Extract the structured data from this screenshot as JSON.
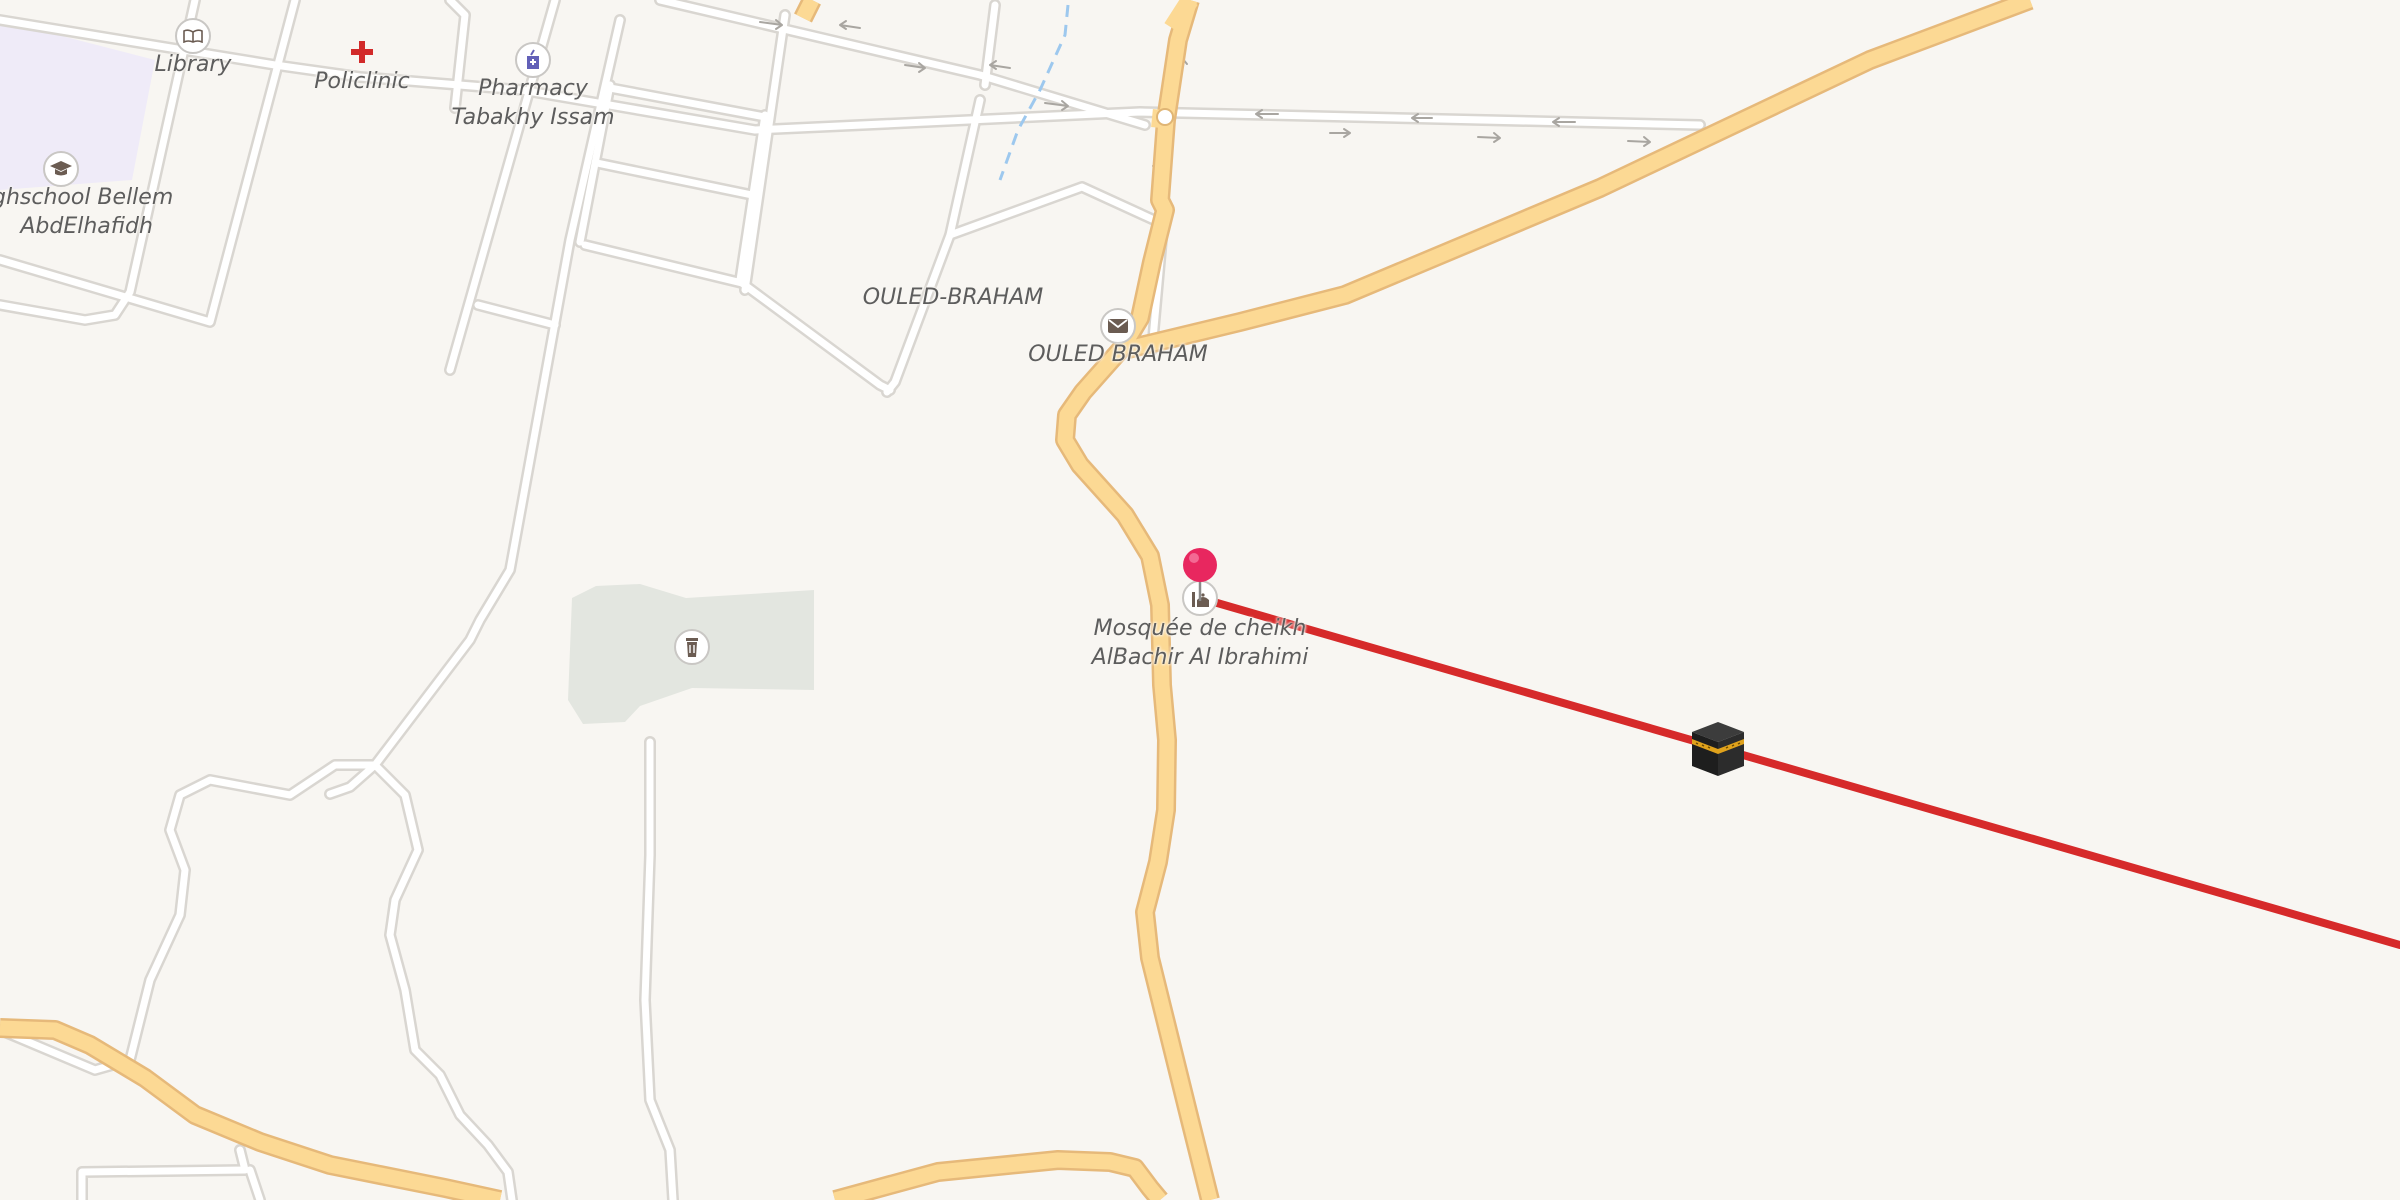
{
  "map": {
    "colors": {
      "background": "#f8f6f2",
      "road_fill": "#fcd994",
      "road_casing": "#e8c07a",
      "street_fill": "#ffffff",
      "street_casing": "#d8d5d0",
      "route_line": "#d62a2a",
      "pin": "#e8275f"
    },
    "labels": {
      "library": "Library",
      "policlinic": "Policlinic",
      "pharmacy_line1": "Pharmacy",
      "pharmacy_line2": "Tabakhy Issam",
      "school_line1": "ghschool Bellem",
      "school_line2": "AbdElhafidh",
      "district": "OULED-BRAHAM",
      "post_office": "OULED BRAHAM",
      "mosque_line1": "Mosquée de cheikh",
      "mosque_line2": "AlBachir Al Ibrahimi"
    },
    "icons": {
      "library": "library-icon",
      "policlinic": "cross-icon",
      "pharmacy": "pharmacy-icon",
      "school": "graduation-cap-icon",
      "post_office": "envelope-icon",
      "cemetery": "grave-icon",
      "mosque": "mosque-icon",
      "pin": "location-pin-icon",
      "qibla_marker": "kaaba-icon"
    }
  }
}
